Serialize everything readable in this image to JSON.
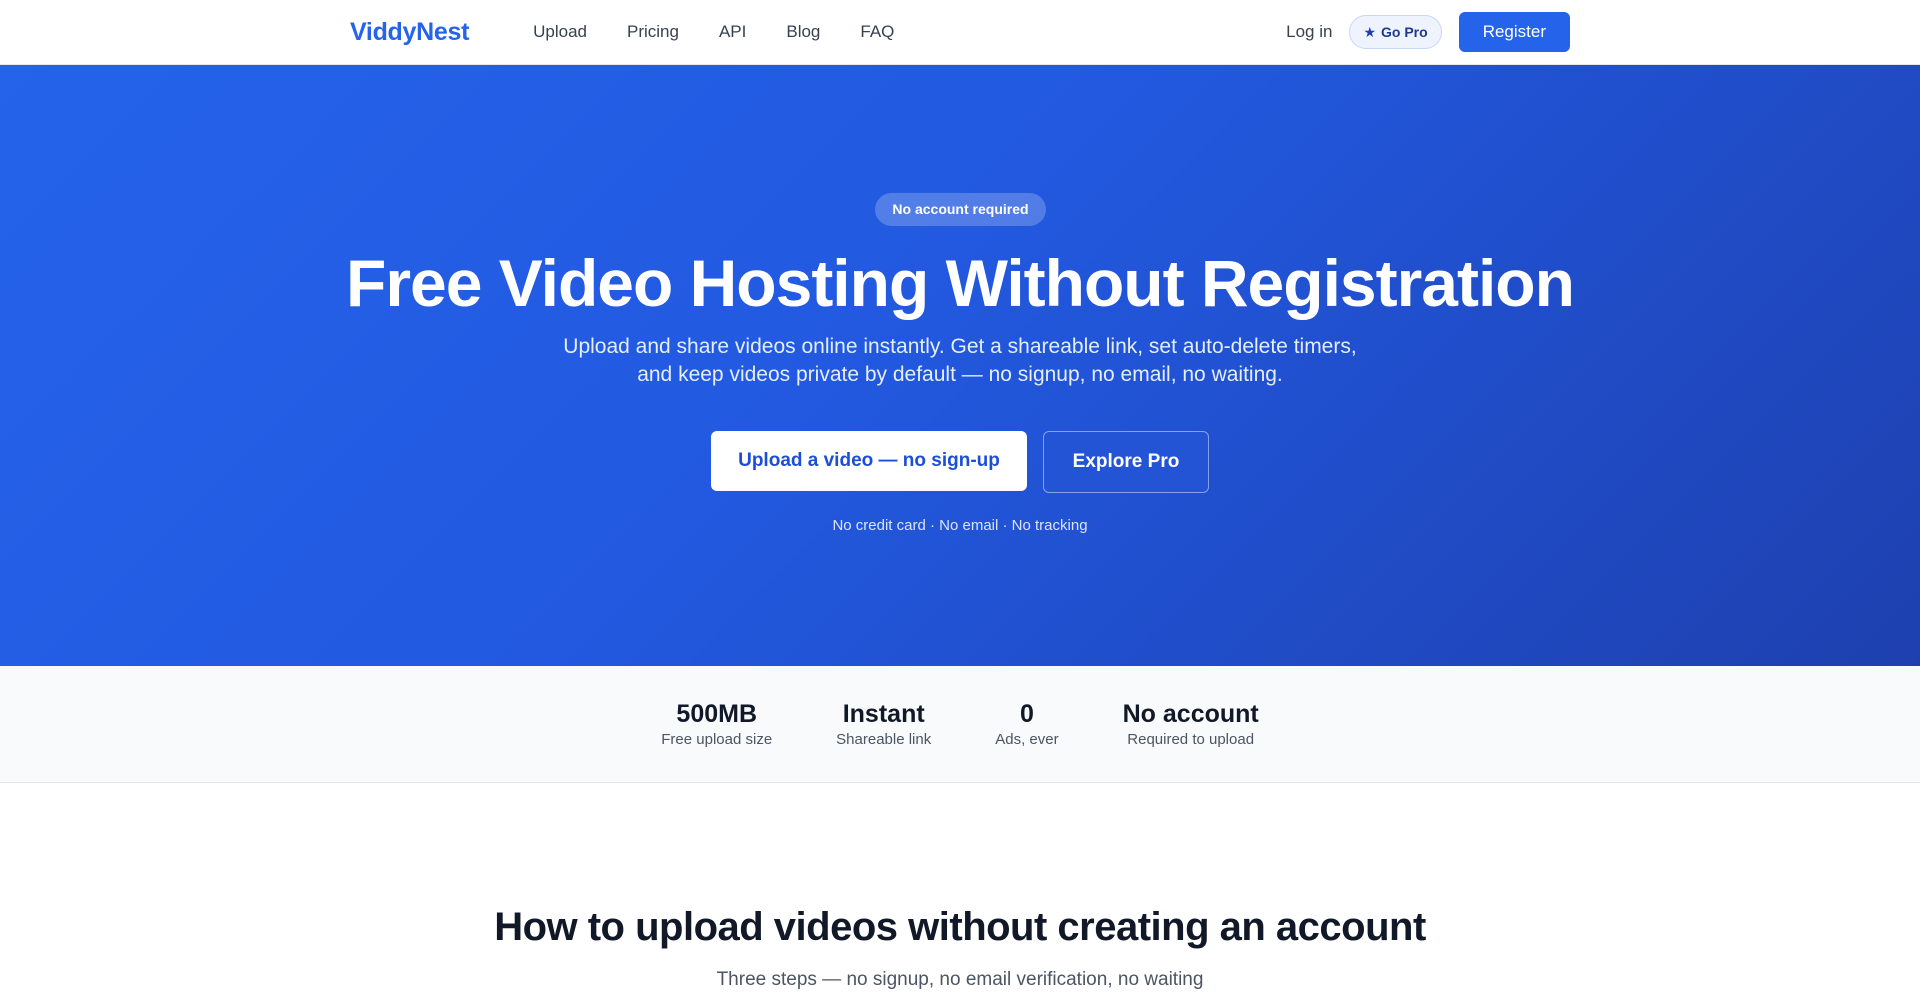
{
  "nav": {
    "logo": "ViddyNest",
    "links": [
      "Upload",
      "Pricing",
      "API",
      "Blog",
      "FAQ"
    ],
    "login": "Log in",
    "gopro": "Go Pro",
    "gopro_icon": "star-icon",
    "register": "Register"
  },
  "hero": {
    "badge": "No account required",
    "title": "Free Video Hosting Without Registration",
    "subtitle": "Upload and share videos online instantly. Get a shareable link, set auto-delete timers, and keep videos private by default — no signup, no email, no waiting.",
    "cta_primary": "Upload a video — no sign-up",
    "cta_secondary": "Explore Pro",
    "note": "No credit card · No email · No tracking"
  },
  "stats": [
    {
      "value": "500MB",
      "label": "Free upload size"
    },
    {
      "value": "Instant",
      "label": "Shareable link"
    },
    {
      "value": "0",
      "label": "Ads, ever"
    },
    {
      "value": "No account",
      "label": "Required to upload"
    }
  ],
  "howto": {
    "title": "How to upload videos without creating an account",
    "subtitle": "Three steps — no signup, no email verification, no waiting"
  },
  "colors": {
    "brand": "#2563eb",
    "hero_dark": "#1e40af"
  }
}
